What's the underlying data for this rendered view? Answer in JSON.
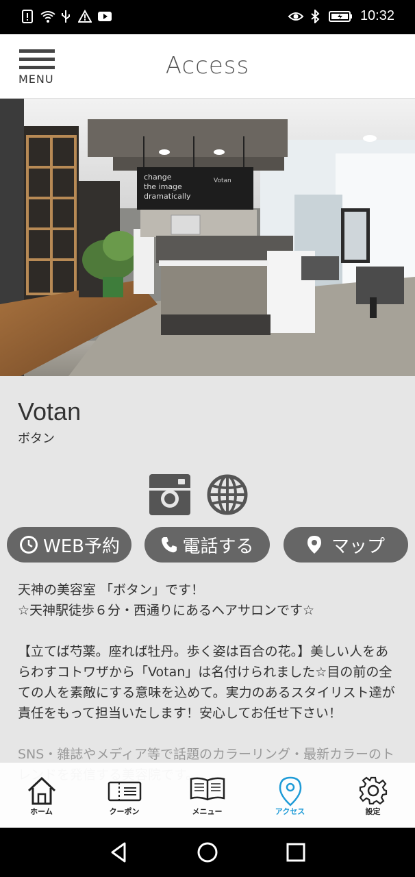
{
  "status_bar": {
    "time": "10:32",
    "left_icons": [
      "notification-alert-icon",
      "wifi-question-icon",
      "usb-icon",
      "warning-icon",
      "youtube-icon"
    ],
    "right_icons": [
      "eye-icon",
      "bluetooth-icon",
      "battery-charging-icon"
    ]
  },
  "header": {
    "menu_label": "MENU",
    "title": "Access"
  },
  "hero": {
    "sign_text_1": "change",
    "sign_text_2": "the image",
    "sign_text_3": "dramatically",
    "counter_brand": "Votan"
  },
  "salon": {
    "name": "Votan",
    "kana": "ボタン"
  },
  "actions": {
    "web_label": "WEB予約",
    "tel_label": "電話する",
    "map_label": "マップ"
  },
  "description": {
    "p1_line1": "天神の美容室 「ボタン」です！",
    "p1_line2": "☆天神駅徒歩６分・西通りにあるヘアサロンです☆",
    "p2": "【立てば芍薬。座れば牡丹。歩く姿は百合の花。】美しい人をあらわすコトワザから「Votan」は名付けられました☆目の前の全ての人を素敵にする意味を込めて。実力のあるスタイリスト達が責任をもって担当いたします！安心してお任せ下さい！",
    "p3": "SNS・雑誌やメディア等で話題のカラーリング・最新カラーのトレンドを発信する美容院です。"
  },
  "tabs": [
    {
      "label": "ホーム",
      "icon": "home-icon"
    },
    {
      "label": "クーポン",
      "icon": "ticket-icon"
    },
    {
      "label": "メニュー",
      "icon": "book-icon"
    },
    {
      "label": "アクセス",
      "icon": "location-pin-icon"
    },
    {
      "label": "設定",
      "icon": "gear-icon"
    }
  ],
  "colors": {
    "accent": "#1e9bd7",
    "button": "#666666",
    "background": "#e6e6e6"
  }
}
